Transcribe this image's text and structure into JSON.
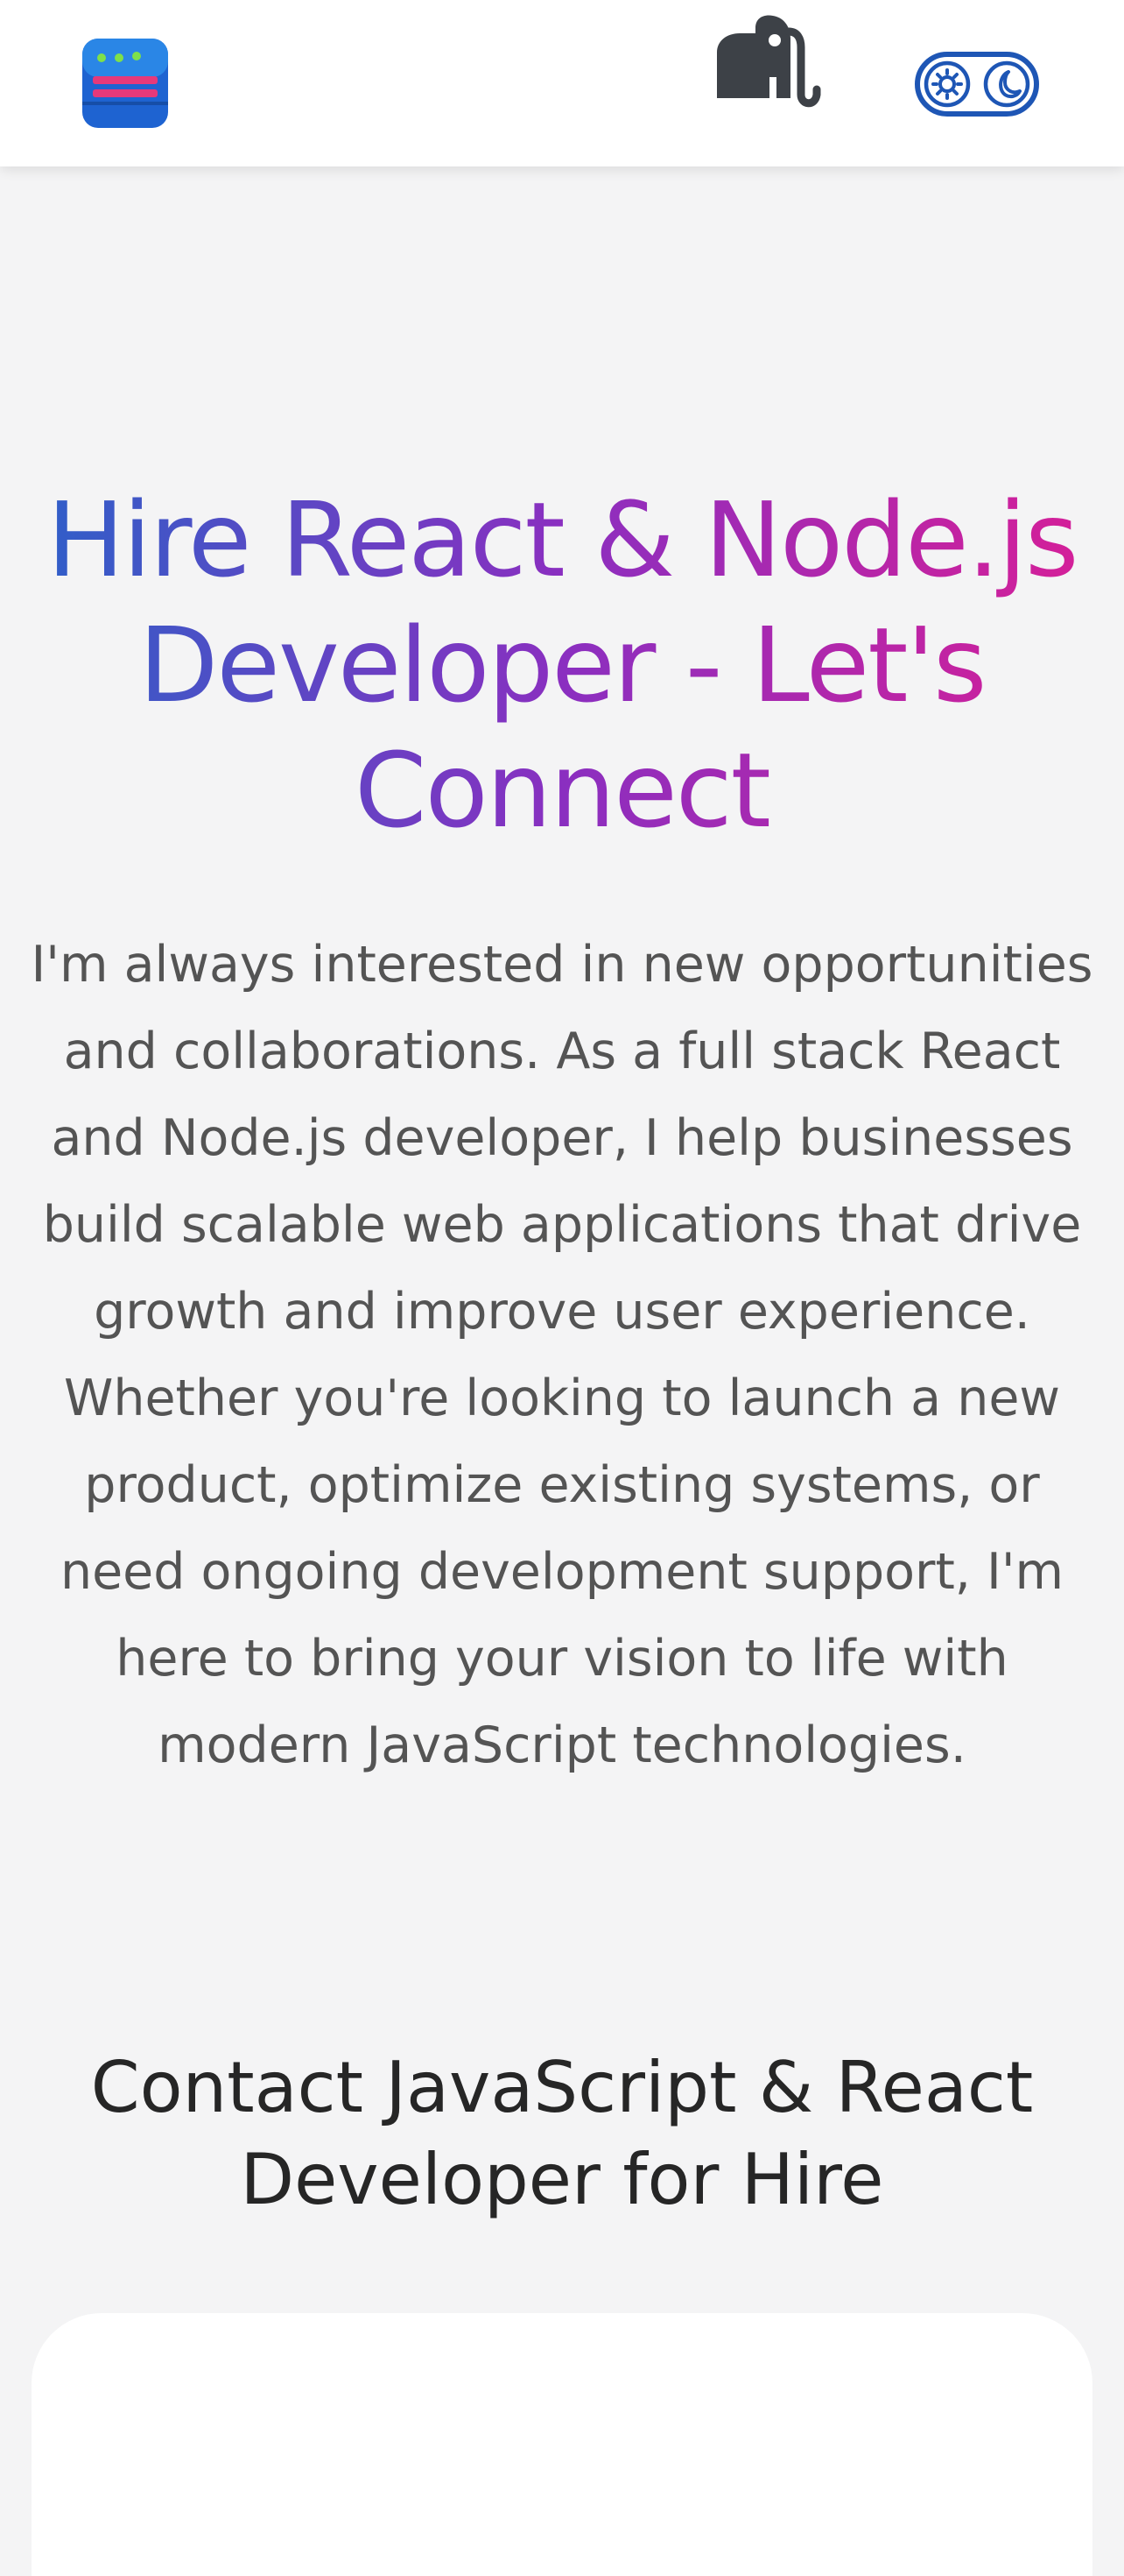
{
  "header": {
    "logo_icon": "server-stack-icon",
    "mastodon_icon": "mastodon-elephant-icon",
    "theme_toggle_icons": [
      "sun-icon",
      "moon-icon"
    ]
  },
  "hero": {
    "title": "Hire React & Node.js Developer - Let's Connect",
    "description": "I'm always interested in new opportunities and collaborations. As a full stack React and Node.js developer, I help businesses build scalable web applications that drive growth and improve user experience. Whether you're looking to launch a new product, optimize existing systems, or need ongoing development support, I'm here to bring your vision to life with modern JavaScript technologies."
  },
  "contact": {
    "title": "Contact JavaScript & React Developer for Hire"
  },
  "colors": {
    "gradient_start": "#2f5fc8",
    "gradient_mid": "#8a2fc0",
    "gradient_end": "#d51f98",
    "toggle_blue": "#1e56b5",
    "page_background": "#f4f4f5"
  }
}
